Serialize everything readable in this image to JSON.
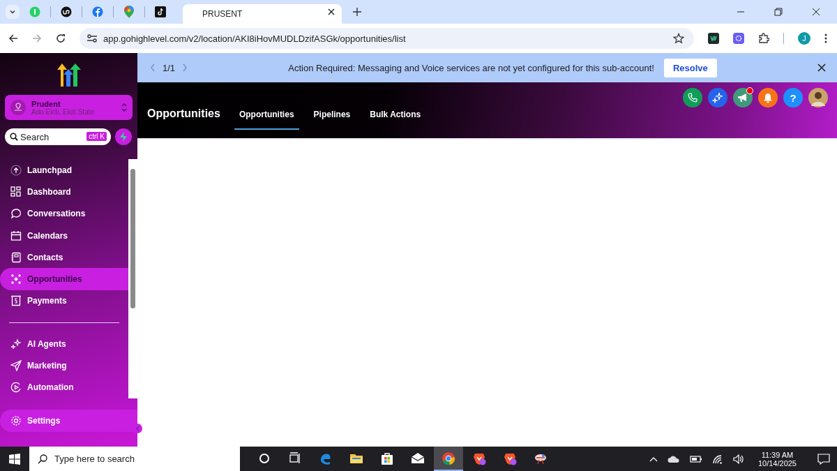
{
  "browser": {
    "pinned_tabs": [
      {
        "kind": "whatsapp"
      },
      {
        "kind": "upwork"
      },
      {
        "kind": "facebook"
      },
      {
        "kind": "maps"
      },
      {
        "kind": "tiktok"
      }
    ],
    "active_tab": {
      "title": "PRUSENT"
    },
    "url": "app.gohighlevel.com/v2/location/AKI8iHovMUDLDzifASGk/opportunities/list",
    "profile_initial": "J"
  },
  "sidebar": {
    "account": {
      "name": "Prudent",
      "location": "Ado Ekiti, Ekiti State"
    },
    "search": {
      "placeholder": "Search",
      "shortcut": "ctrl K"
    },
    "items": [
      {
        "label": "Launchpad",
        "selected": false
      },
      {
        "label": "Dashboard",
        "selected": false
      },
      {
        "label": "Conversations",
        "selected": false
      },
      {
        "label": "Calendars",
        "selected": false
      },
      {
        "label": "Contacts",
        "selected": false
      },
      {
        "label": "Opportunities",
        "selected": true
      },
      {
        "label": "Payments",
        "selected": false
      },
      {
        "kind": "divider"
      },
      {
        "label": "AI Agents",
        "selected": false
      },
      {
        "label": "Marketing",
        "selected": false
      },
      {
        "label": "Automation",
        "selected": false
      }
    ],
    "settings": {
      "label": "Settings"
    }
  },
  "banner": {
    "pager": "1/1",
    "message": "Action Required: Messaging and Voice services are not yet configured for this sub-account!",
    "button": "Resolve"
  },
  "header": {
    "title": "Opportunities",
    "tabs": [
      {
        "label": "Opportunities",
        "selected": true
      },
      {
        "label": "Pipelines",
        "selected": false
      },
      {
        "label": "Bulk Actions",
        "selected": false
      }
    ],
    "actions": [
      {
        "kind": "phone",
        "color": "#0f9d58",
        "badge": false
      },
      {
        "kind": "sparkle",
        "color": "#2563eb",
        "badge": false
      },
      {
        "kind": "megaphone",
        "color": "#3f9a7a",
        "badge": true
      },
      {
        "kind": "bell",
        "color": "#f97316",
        "badge": false
      },
      {
        "kind": "help",
        "color": "#1e90ff",
        "badge": false,
        "text": "?"
      }
    ]
  },
  "taskbar": {
    "search_placeholder": "Type here to search",
    "apps": [
      {
        "kind": "cortana",
        "selected": false
      },
      {
        "kind": "taskview",
        "selected": false
      },
      {
        "kind": "edge",
        "selected": false
      },
      {
        "kind": "explorer",
        "selected": false
      },
      {
        "kind": "store",
        "selected": false
      },
      {
        "kind": "mail",
        "selected": false
      },
      {
        "kind": "chrome",
        "selected": true
      },
      {
        "kind": "brave",
        "selected": false
      },
      {
        "kind": "brave",
        "selected": false
      },
      {
        "kind": "snip",
        "selected": false
      }
    ],
    "time": "11:39 AM",
    "date": "10/14/2025"
  }
}
